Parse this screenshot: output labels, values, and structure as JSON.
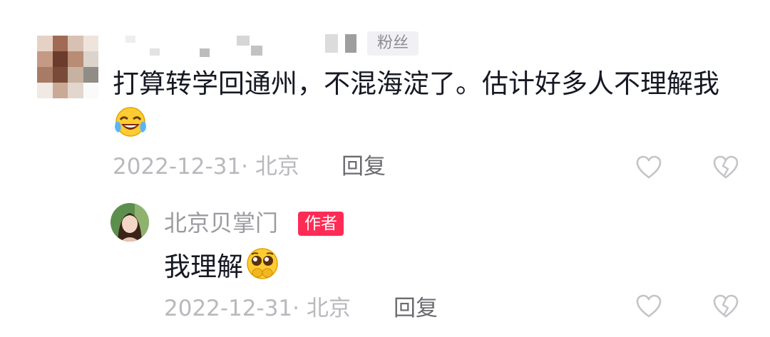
{
  "colors": {
    "text_primary": "#161823",
    "text_meta": "#b9b9bd",
    "badge_author_bg": "#fe2c55",
    "badge_fan_bg": "#f1f1f3"
  },
  "comment": {
    "badge": "粉丝",
    "text": "打算转学回通州，不混海淀了。估计好多人不理解我",
    "emoji": "laughing-crying-emoji",
    "date": "2022-12-31",
    "location": "· 北京",
    "reply_label": "回复",
    "like_icon": "heart-outline-icon",
    "dislike_icon": "broken-heart-icon"
  },
  "reply": {
    "author": "北京贝掌门",
    "author_badge": "作者",
    "text": "我理解",
    "emoji": "pleading-face-emoji",
    "date": "2022-12-31",
    "location": "· 北京",
    "reply_label": "回复",
    "like_icon": "heart-outline-icon",
    "dislike_icon": "broken-heart-icon"
  }
}
